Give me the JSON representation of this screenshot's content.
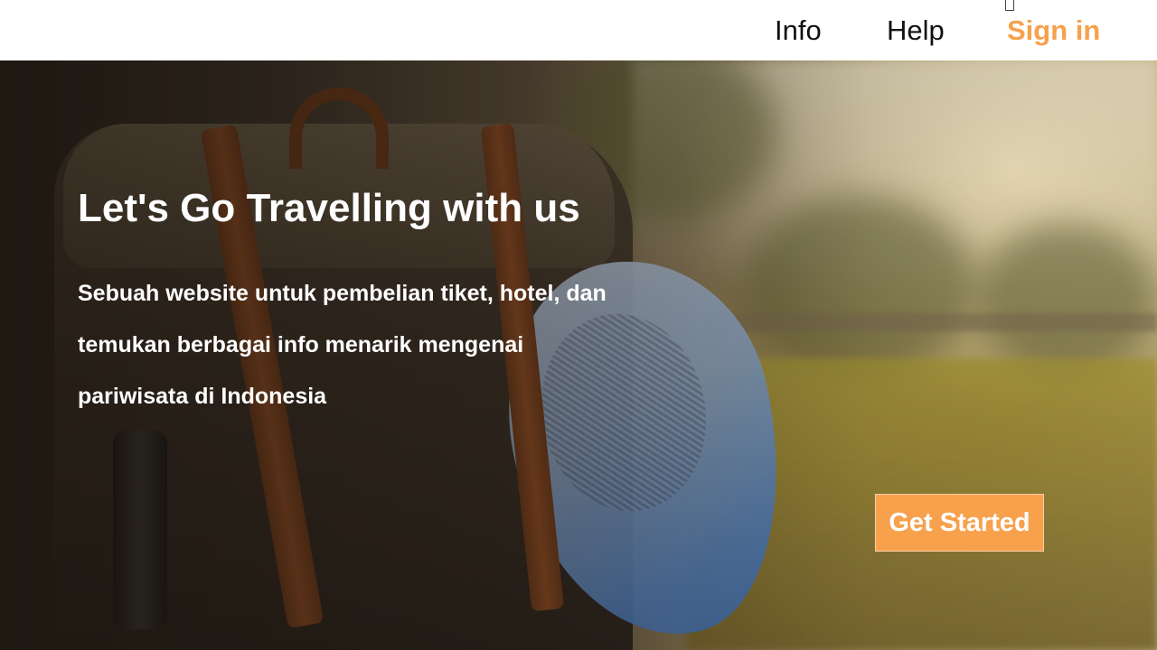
{
  "nav": {
    "links": [
      {
        "label": "Info"
      },
      {
        "label": "Help"
      },
      {
        "label": "Sign in"
      }
    ]
  },
  "hero": {
    "title": "Let's Go Travelling with us",
    "description_lines": [
      "Sebuah website untuk pembelian tiket, hotel, dan",
      "temukan berbagai info menarik mengenai",
      "pariwisata di Indonesia"
    ],
    "cta_label": "Get Started"
  },
  "colors": {
    "accent": "#f7a14d",
    "nav_text": "#111111",
    "hero_text": "#ffffff"
  },
  "icons": {
    "missing_glyph": "broken-glyph-icon",
    "background": "backpack-sunset-photo"
  }
}
